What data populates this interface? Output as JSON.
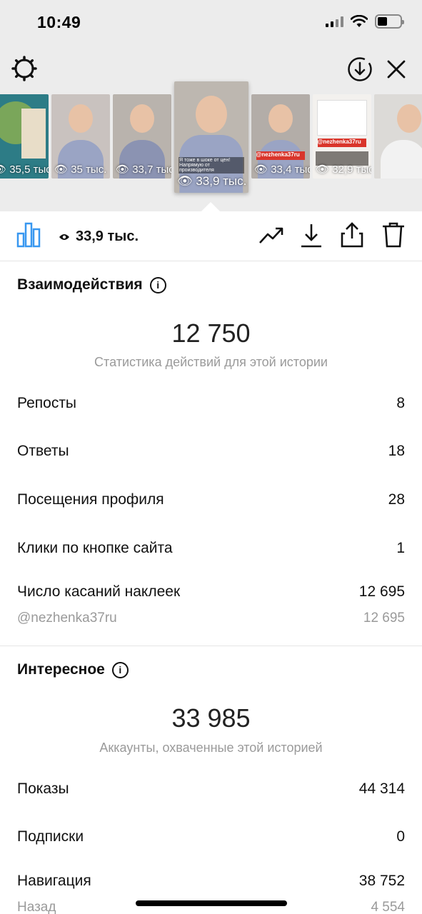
{
  "status_bar": {
    "time": "10:49"
  },
  "stories": [
    {
      "views": "35,5 тыс."
    },
    {
      "views": "35 тыс."
    },
    {
      "views": "33,7 тыс."
    },
    {
      "views": "33,9 тыс.",
      "active": true
    },
    {
      "views": "33,4 тыс."
    },
    {
      "views": "32,9 тыс."
    },
    {
      "views": ""
    }
  ],
  "story_overlay_text": {
    "active": "Я тоже в шоке от цен! Напрямую от производителя",
    "tag_1": "@nezhenka37ru",
    "tag_2": "@nezhenka37ru"
  },
  "action_bar": {
    "reach": "33,9 тыс."
  },
  "interactions": {
    "title": "Взаимодействия",
    "total": "12 750",
    "subtitle": "Статистика действий для этой истории",
    "rows": [
      {
        "label": "Репосты",
        "value": "8"
      },
      {
        "label": "Ответы",
        "value": "18"
      },
      {
        "label": "Посещения профиля",
        "value": "28"
      },
      {
        "label": "Клики по кнопке сайта",
        "value": "1"
      },
      {
        "label": "Число касаний наклеек",
        "value": "12 695"
      }
    ],
    "sticker_detail": {
      "label": "@nezhenka37ru",
      "value": "12 695"
    }
  },
  "discovery": {
    "title": "Интересное",
    "total": "33 985",
    "subtitle": "Аккаунты, охваченные этой историей",
    "rows": [
      {
        "label": "Показы",
        "value": "44 314"
      },
      {
        "label": "Подписки",
        "value": "0"
      },
      {
        "label": "Навигация",
        "value": "38 752"
      }
    ],
    "nav_detail": {
      "label": "Назад",
      "value": "4 554"
    }
  },
  "colors": {
    "accent": "#3897f0",
    "muted": "#9a9a9a",
    "tag_red": "#d9352b"
  }
}
